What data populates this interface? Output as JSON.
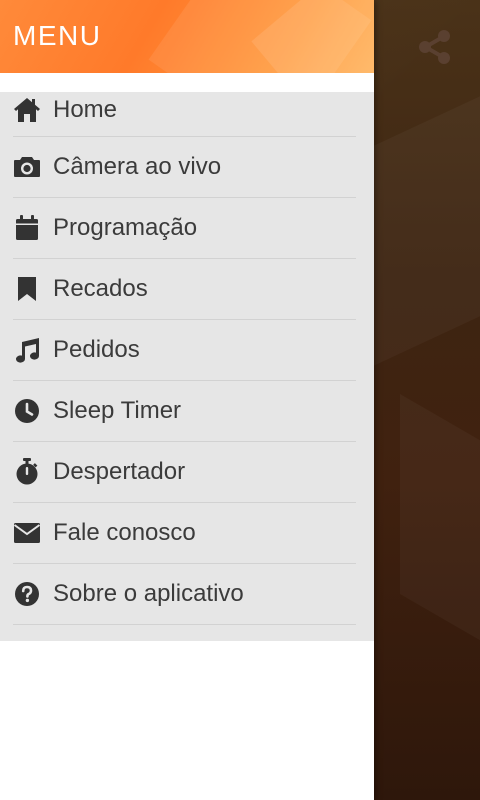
{
  "drawer": {
    "title": "MENU",
    "items": [
      {
        "label": "Home",
        "icon": "home-icon"
      },
      {
        "label": "Câmera ao vivo",
        "icon": "camera-icon"
      },
      {
        "label": "Programação",
        "icon": "calendar-icon"
      },
      {
        "label": "Recados",
        "icon": "bookmark-icon"
      },
      {
        "label": "Pedidos",
        "icon": "music-note-icon"
      },
      {
        "label": "Sleep Timer",
        "icon": "clock-icon"
      },
      {
        "label": "Despertador",
        "icon": "stopwatch-icon"
      },
      {
        "label": "Fale conosco",
        "icon": "envelope-icon"
      },
      {
        "label": "Sobre o aplicativo",
        "icon": "question-circle-icon"
      }
    ]
  },
  "app": {
    "share_icon": "share-icon"
  },
  "colors": {
    "header_orange": "#ff7a2a",
    "menu_bg": "#e6e6e6",
    "text": "#3b3b3b",
    "icon": "#333333"
  }
}
